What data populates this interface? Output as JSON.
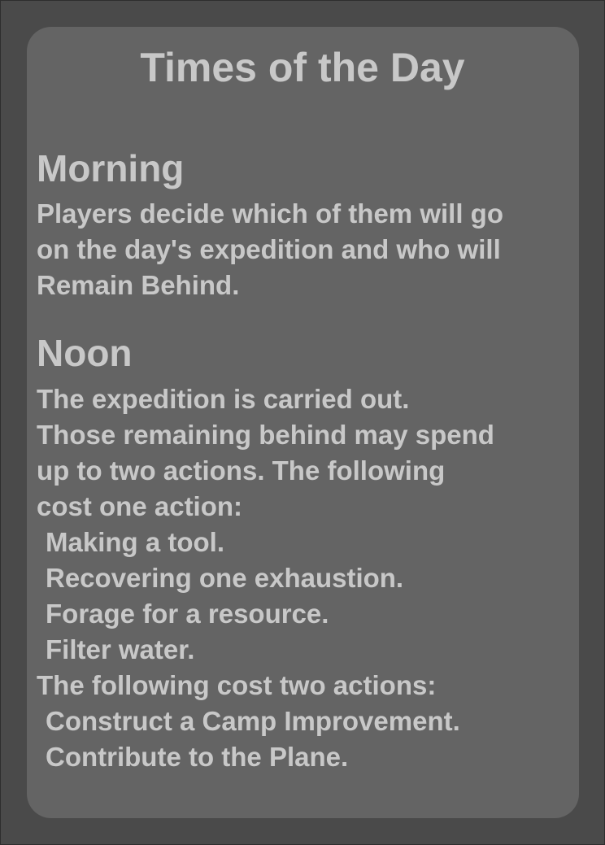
{
  "card": {
    "title": "Times of the Day",
    "colors": {
      "background": "#4a4a4a",
      "card": "#646464",
      "text": "#c8c8c8"
    },
    "sections": [
      {
        "heading": "Morning",
        "lines": [
          "Players decide which of them will go",
          "on the day's expedition and who will",
          "Remain Behind."
        ]
      },
      {
        "heading": "Noon",
        "lines": [
          "The expedition is carried out.",
          "Those remaining behind may spend",
          "up to two actions. The following",
          "cost one action:"
        ],
        "one_action_items": [
          "Making a tool.",
          "Recovering one exhaustion.",
          "Forage for a resource.",
          "Filter water."
        ],
        "two_action_header": "The following cost two actions:",
        "two_action_items": [
          "Construct a Camp Improvement.",
          "Contribute to the Plane."
        ]
      }
    ]
  }
}
